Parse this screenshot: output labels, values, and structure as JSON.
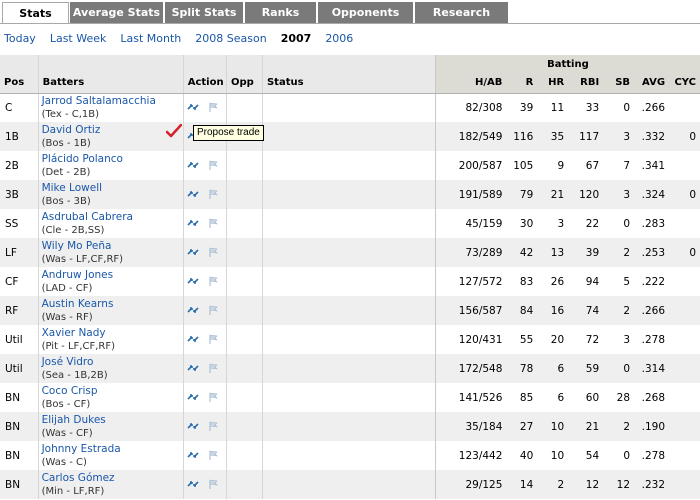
{
  "tabs": [
    {
      "label": "Stats",
      "active": true
    },
    {
      "label": "Average Stats",
      "active": false
    },
    {
      "label": "Split Stats",
      "active": false
    },
    {
      "label": "Ranks",
      "active": false
    },
    {
      "label": "Opponents",
      "active": false
    },
    {
      "label": "Research",
      "active": false
    }
  ],
  "filters": [
    {
      "label": "Today",
      "current": false
    },
    {
      "label": "Last Week",
      "current": false
    },
    {
      "label": "Last Month",
      "current": false
    },
    {
      "label": "2008 Season",
      "current": false
    },
    {
      "label": "2007",
      "current": true
    },
    {
      "label": "2006",
      "current": false
    }
  ],
  "table": {
    "group_label": "Batting",
    "headers": {
      "pos": "Pos",
      "batters": "Batters",
      "action": "Action",
      "opp": "Opp",
      "status": "Status",
      "stats": [
        "H/AB",
        "R",
        "HR",
        "RBI",
        "SB",
        "AVG",
        "CYC"
      ]
    },
    "rows": [
      {
        "pos": "C",
        "name": "Jarrod Saltalamacchia",
        "team": "(Tex - C,1B)",
        "stats": [
          "82/308",
          "39",
          "11",
          "33",
          "0",
          ".266",
          ""
        ]
      },
      {
        "pos": "1B",
        "name": "David Ortiz",
        "team": "(Bos - 1B)",
        "stats": [
          "182/549",
          "116",
          "35",
          "117",
          "3",
          ".332",
          "0"
        ]
      },
      {
        "pos": "2B",
        "name": "Plácido Polanco",
        "team": "(Det - 2B)",
        "stats": [
          "200/587",
          "105",
          "9",
          "67",
          "7",
          ".341",
          ""
        ]
      },
      {
        "pos": "3B",
        "name": "Mike Lowell",
        "team": "(Bos - 3B)",
        "stats": [
          "191/589",
          "79",
          "21",
          "120",
          "3",
          ".324",
          "0"
        ]
      },
      {
        "pos": "SS",
        "name": "Asdrubal Cabrera",
        "team": "(Cle - 2B,SS)",
        "stats": [
          "45/159",
          "30",
          "3",
          "22",
          "0",
          ".283",
          ""
        ]
      },
      {
        "pos": "LF",
        "name": "Wily Mo Peña",
        "team": "(Was - LF,CF,RF)",
        "stats": [
          "73/289",
          "42",
          "13",
          "39",
          "2",
          ".253",
          "0"
        ]
      },
      {
        "pos": "CF",
        "name": "Andruw Jones",
        "team": "(LAD - CF)",
        "stats": [
          "127/572",
          "83",
          "26",
          "94",
          "5",
          ".222",
          ""
        ]
      },
      {
        "pos": "RF",
        "name": "Austin Kearns",
        "team": "(Was - RF)",
        "stats": [
          "156/587",
          "84",
          "16",
          "74",
          "2",
          ".266",
          ""
        ]
      },
      {
        "pos": "Util",
        "name": "Xavier Nady",
        "team": "(Pit - LF,CF,RF)",
        "stats": [
          "120/431",
          "55",
          "20",
          "72",
          "3",
          ".278",
          ""
        ]
      },
      {
        "pos": "Util",
        "name": "José Vidro",
        "team": "(Sea - 1B,2B)",
        "stats": [
          "172/548",
          "78",
          "6",
          "59",
          "0",
          ".314",
          ""
        ]
      },
      {
        "pos": "BN",
        "name": "Coco Crisp",
        "team": "(Bos - CF)",
        "stats": [
          "141/526",
          "85",
          "6",
          "60",
          "28",
          ".268",
          ""
        ]
      },
      {
        "pos": "BN",
        "name": "Elijah Dukes",
        "team": "(Was - CF)",
        "stats": [
          "35/184",
          "27",
          "10",
          "21",
          "2",
          ".190",
          ""
        ]
      },
      {
        "pos": "BN",
        "name": "Johnny Estrada",
        "team": "(Was - C)",
        "stats": [
          "123/442",
          "40",
          "10",
          "54",
          "0",
          ".278",
          ""
        ]
      },
      {
        "pos": "BN",
        "name": "Carlos Gómez",
        "team": "(Min - LF,RF)",
        "stats": [
          "29/125",
          "14",
          "2",
          "12",
          "12",
          ".232",
          ""
        ]
      }
    ]
  },
  "tooltip": {
    "text": "Propose trade"
  },
  "icons": {
    "trade": "trade-arrows-icon",
    "watch": "flag-icon",
    "check": "checkmark-icon"
  },
  "colors": {
    "tab_bg": "#7a7a7a",
    "link": "#1a57a8",
    "alt_row": "#efefef",
    "header_bg": "#e9e9e9",
    "batting_header_bg": "#dcdcd5",
    "check": "#d4222a"
  }
}
